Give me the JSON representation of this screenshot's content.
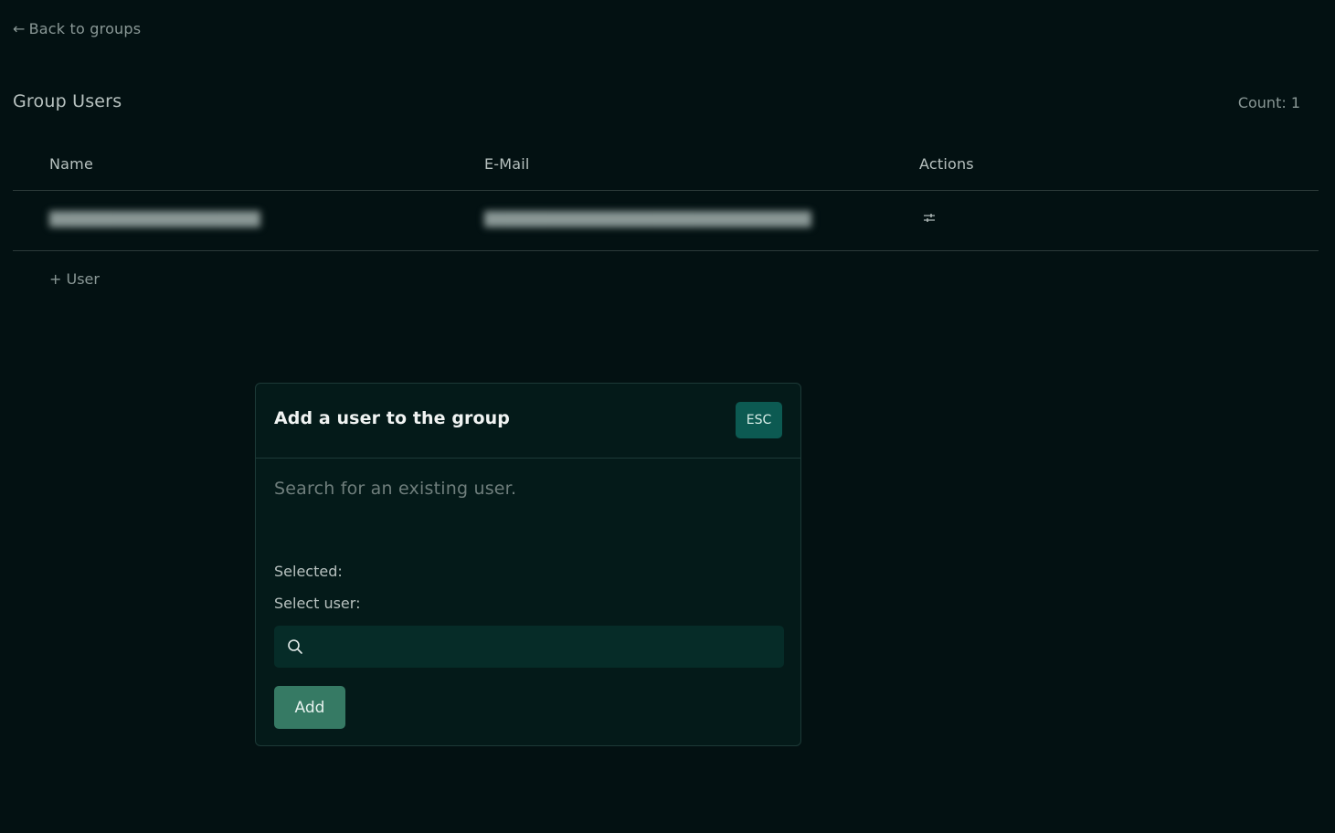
{
  "nav": {
    "back_arrow": "←",
    "back_label": "Back to groups"
  },
  "section": {
    "title": "Group Users",
    "count": "Count: 1"
  },
  "table": {
    "headers": [
      "Name",
      "E-Mail",
      "Actions"
    ],
    "rows": [
      {
        "name": "",
        "email": "",
        "action_icon": "sliders-icon"
      }
    ],
    "add_user_label": "+ User"
  },
  "modal": {
    "title": "Add a user to the group",
    "esc_label": "ESC",
    "description": "Search for an existing user.",
    "selected_label": "Selected:",
    "select_user_label": "Select user:",
    "search_value": "",
    "search_icon": "search-icon",
    "add_label": "Add"
  },
  "colors": {
    "background": "#031112",
    "modal_background": "#041a19",
    "esc_button": "#0c5a52",
    "add_button": "#367a64",
    "search_field": "#062c28"
  }
}
